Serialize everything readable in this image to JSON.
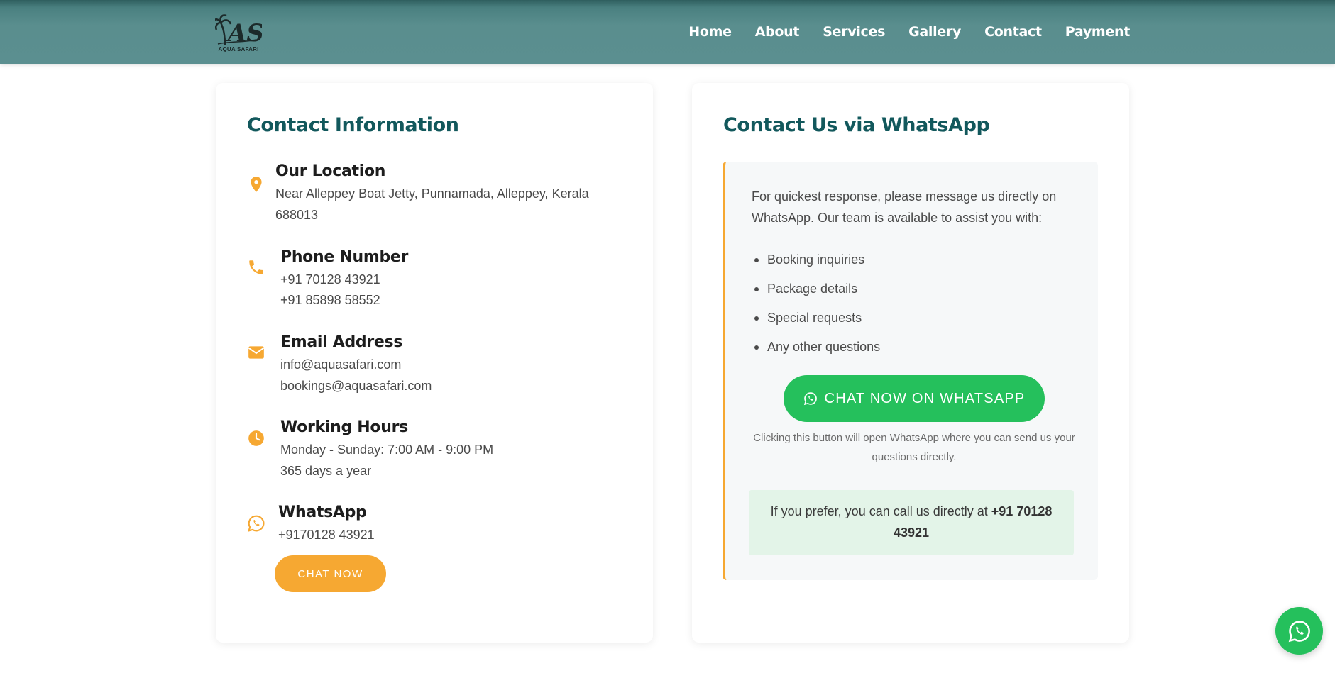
{
  "brand": {
    "logo_text": "AQUA SAFARI",
    "logo_mark": "AS",
    "logo_icon": "palm-tree-icon"
  },
  "nav": {
    "items": [
      {
        "label": "Home"
      },
      {
        "label": "About"
      },
      {
        "label": "Services"
      },
      {
        "label": "Gallery"
      },
      {
        "label": "Contact"
      },
      {
        "label": "Payment"
      }
    ]
  },
  "contact_info": {
    "title": "Contact Information",
    "location": {
      "icon": "map-pin-icon",
      "title": "Our Location",
      "line1": "Near Alleppey Boat Jetty, Punnamada, Alleppey, Kerala",
      "line2": "688013"
    },
    "phone": {
      "icon": "phone-icon",
      "title": "Phone Number",
      "line1": "+91 70128 43921",
      "line2": "+91 85898 58552"
    },
    "email": {
      "icon": "envelope-icon",
      "title": "Email Address",
      "line1": "info@aquasafari.com",
      "line2": "bookings@aquasafari.com"
    },
    "hours": {
      "icon": "clock-icon",
      "title": "Working Hours",
      "line1": "Monday - Sunday: 7:00 AM - 9:00 PM",
      "line2": "365 days a year"
    },
    "whatsapp": {
      "icon": "whatsapp-icon",
      "title": "WhatsApp",
      "line1": "+9170128 43921",
      "button_label": "CHAT NOW"
    }
  },
  "whatsapp_panel": {
    "title": "Contact Us via WhatsApp",
    "intro": "For quickest response, please message us directly on WhatsApp. Our team is available to assist you with:",
    "list": [
      {
        "text": "Booking inquiries"
      },
      {
        "text": "Package details"
      },
      {
        "text": "Special requests"
      },
      {
        "text": "Any other questions"
      }
    ],
    "button_label": "CHAT NOW ON WHATSAPP",
    "note": "Clicking this button will open WhatsApp where you can send us your questions directly.",
    "call_prefix": "If you prefer, you can call us directly at ",
    "call_number": "+91 70128 43921"
  },
  "floating_button": {
    "icon": "whatsapp-icon"
  },
  "colors": {
    "header": "#5b8f90",
    "accent": "#f6a832",
    "title": "#12585c",
    "whatsapp": "#25c05c",
    "call_box": "#e3f4e8"
  }
}
